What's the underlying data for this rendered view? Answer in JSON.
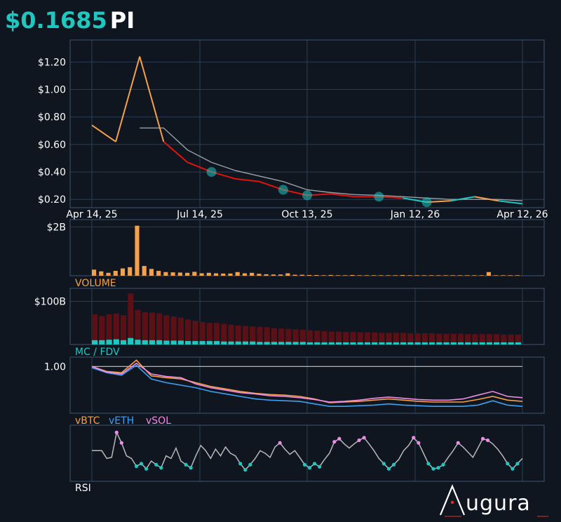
{
  "header": {
    "price": "$0.1685",
    "symbol": "PI"
  },
  "brand": {
    "name": "ugura"
  },
  "colors": {
    "background": "#0f1620",
    "grid": "#2b3d52",
    "frame": "#3e5470",
    "orange": "#f5a04a",
    "red": "#e0140e",
    "teal": "#1fc7c1",
    "gray": "#9aa0a8",
    "blue": "#3fa0f0",
    "pink": "#ef8be6",
    "darkred": "#5a1015",
    "white": "#ffffff"
  },
  "panel_labels": {
    "volume": "VOLUME",
    "mc_fdv": "MC / FDV",
    "vbtc": "vBTC",
    "veth": "vETH",
    "vsol": "vSOL",
    "rsi": "RSI"
  },
  "chart_data": [
    {
      "type": "line",
      "panel": "price",
      "x_dates": [
        "Apr 14, 25",
        "May 5, 25",
        "May 26, 25",
        "Jun 16, 25",
        "Jul 7, 25",
        "Jul 28, 25",
        "Aug 18, 25",
        "Sep 8, 25",
        "Sep 29, 25",
        "Oct 20, 25",
        "Nov 10, 25",
        "Dec 1, 25",
        "Dec 22, 25",
        "Jan 12, 26",
        "Feb 2, 26",
        "Feb 23, 26",
        "Mar 16, 26",
        "Apr 6, 26",
        "Apr 12, 26"
      ],
      "series": [
        {
          "values": [
            0.74,
            0.62,
            1.24,
            0.62,
            0.47,
            0.4,
            0.35,
            0.33,
            0.27,
            0.23,
            0.24,
            0.22,
            0.22,
            0.21,
            0.18,
            0.19,
            0.22,
            0.19,
            0.1685
          ]
        },
        {
          "values": [
            null,
            null,
            0.72,
            0.72,
            0.56,
            0.47,
            0.41,
            0.37,
            0.33,
            0.27,
            0.25,
            0.235,
            0.23,
            0.22,
            0.21,
            0.2,
            0.2,
            0.2,
            0.19
          ]
        }
      ],
      "xticks": [
        "Apr 14, 25",
        "Jul 14, 25",
        "Oct 13, 25",
        "Jan 12, 26",
        "Apr 12, 26"
      ],
      "yticks": [
        "$0.20",
        "$0.40",
        "$0.60",
        "$0.80",
        "$1.00",
        "$1.20"
      ],
      "ylim": [
        0.14,
        1.36
      ],
      "grid": true
    },
    {
      "type": "bar",
      "panel": "volume",
      "yticks": [
        "$2B"
      ],
      "ylim": [
        0,
        2.3
      ],
      "values_billions": [
        0.25,
        0.18,
        0.12,
        0.2,
        0.3,
        0.35,
        2.05,
        0.4,
        0.28,
        0.2,
        0.15,
        0.14,
        0.13,
        0.12,
        0.16,
        0.1,
        0.12,
        0.1,
        0.09,
        0.09,
        0.15,
        0.1,
        0.12,
        0.08,
        0.06,
        0.05,
        0.05,
        0.1,
        0.04,
        0.04,
        0.03,
        0.03,
        0.02,
        0.03,
        0.02,
        0.02,
        0.03,
        0.02,
        0.02,
        0.02,
        0.02,
        0.02,
        0.02,
        0.03,
        0.02,
        0.02,
        0.02,
        0.02,
        0.02,
        0.02,
        0.02,
        0.02,
        0.02,
        0.02,
        0.02,
        0.15,
        0.02,
        0.02,
        0.02,
        0.02
      ]
    },
    {
      "type": "bar",
      "panel": "mc_fdv",
      "yticks": [
        "$100B"
      ],
      "ylim": [
        0,
        130
      ],
      "series": [
        {
          "values": [
            70,
            66,
            70,
            72,
            68,
            118,
            80,
            75,
            74,
            72,
            68,
            65,
            62,
            58,
            55,
            52,
            50,
            50,
            48,
            46,
            44,
            43,
            42,
            41,
            40,
            38,
            37,
            36,
            35,
            34,
            33,
            32,
            31,
            30,
            30,
            29,
            29,
            28,
            28,
            28,
            27,
            27,
            27,
            27,
            26,
            26,
            26,
            26,
            25,
            25,
            25,
            25,
            24,
            24,
            24,
            24,
            24,
            23,
            23,
            23
          ]
        },
        {
          "values": [
            10,
            10,
            11,
            12,
            10,
            15,
            11,
            10,
            10,
            10,
            9,
            9,
            9,
            8,
            8,
            8,
            8,
            8,
            7,
            7,
            7,
            7,
            7,
            6,
            6,
            6,
            6,
            6,
            6,
            6,
            5,
            5,
            5,
            5,
            5,
            5,
            5,
            5,
            5,
            5,
            5,
            5,
            5,
            5,
            5,
            5,
            5,
            5,
            5,
            5,
            5,
            5,
            5,
            5,
            5,
            5,
            5,
            5,
            5,
            5
          ]
        }
      ]
    },
    {
      "type": "line",
      "panel": "relative",
      "yticks": [
        "1.00"
      ],
      "ylim": [
        0.25,
        1.15
      ],
      "series": [
        {
          "name": "vBTC",
          "values": [
            1.0,
            0.92,
            0.9,
            1.1,
            0.85,
            0.82,
            0.8,
            0.74,
            0.68,
            0.64,
            0.6,
            0.57,
            0.55,
            0.54,
            0.52,
            0.48,
            0.42,
            0.43,
            0.44,
            0.46,
            0.48,
            0.46,
            0.44,
            0.43,
            0.43,
            0.43,
            0.47,
            0.52,
            0.46,
            0.44
          ]
        },
        {
          "name": "vETH",
          "values": [
            0.98,
            0.9,
            0.86,
            1.02,
            0.8,
            0.74,
            0.7,
            0.66,
            0.6,
            0.56,
            0.52,
            0.48,
            0.46,
            0.45,
            0.44,
            0.4,
            0.36,
            0.36,
            0.37,
            0.38,
            0.4,
            0.38,
            0.37,
            0.36,
            0.36,
            0.36,
            0.38,
            0.45,
            0.38,
            0.36
          ]
        },
        {
          "name": "vSOL",
          "values": [
            1.0,
            0.91,
            0.88,
            1.05,
            0.88,
            0.84,
            0.82,
            0.72,
            0.66,
            0.62,
            0.58,
            0.56,
            0.53,
            0.52,
            0.5,
            0.47,
            0.43,
            0.44,
            0.46,
            0.49,
            0.51,
            0.49,
            0.47,
            0.46,
            0.46,
            0.48,
            0.54,
            0.6,
            0.52,
            0.5
          ]
        }
      ]
    },
    {
      "type": "line",
      "panel": "rsi",
      "ylim": [
        0,
        100
      ],
      "values": [
        55,
        55,
        55,
        40,
        42,
        90,
        70,
        45,
        40,
        25,
        30,
        20,
        35,
        28,
        22,
        45,
        40,
        60,
        35,
        28,
        22,
        45,
        65,
        55,
        40,
        58,
        45,
        62,
        50,
        45,
        30,
        18,
        28,
        40,
        55,
        50,
        42,
        62,
        70,
        58,
        48,
        55,
        42,
        28,
        22,
        30,
        24,
        38,
        50,
        72,
        78,
        68,
        60,
        68,
        75,
        80,
        68,
        55,
        40,
        30,
        20,
        28,
        38,
        55,
        65,
        80,
        70,
        50,
        30,
        20,
        22,
        28,
        42,
        55,
        70,
        62,
        52,
        42,
        60,
        78,
        75,
        68,
        58,
        45,
        30,
        20,
        30,
        40
      ]
    }
  ]
}
